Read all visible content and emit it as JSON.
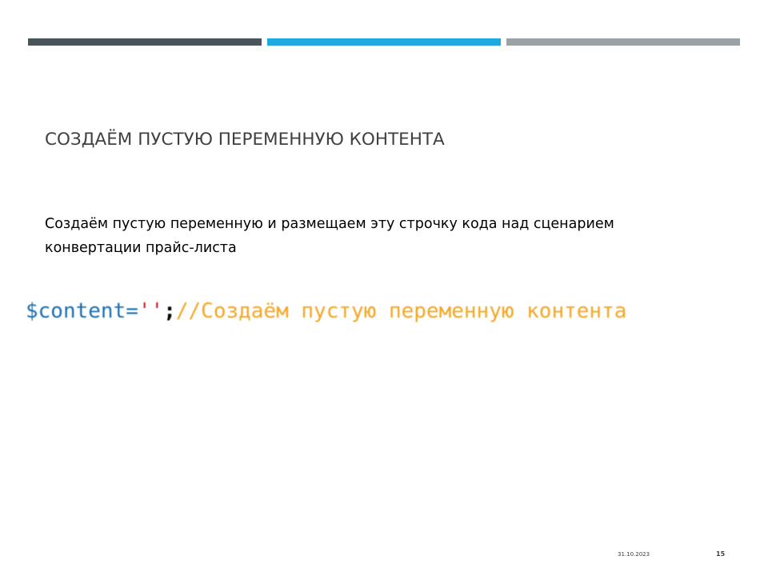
{
  "accent_colors": {
    "bar_1": "#48545a",
    "bar_2": "#1ea9e1",
    "bar_3": "#9aa1a7"
  },
  "slide": {
    "title": "СОЗДАЁМ ПУСТУЮ ПЕРЕМЕННУЮ КОНТЕНТА",
    "body_line_1": "Создаём пустую переменную и размещаем эту строчку кода над сценарием",
    "body_line_2": "конвертации прайс-листа",
    "code": {
      "variable": "$content",
      "operator": "=",
      "string": "''",
      "semicolon": ";",
      "comment": "//Создаём пустую переменную контента"
    },
    "footer": {
      "date": "31.10.2023",
      "page_number": "15"
    }
  }
}
